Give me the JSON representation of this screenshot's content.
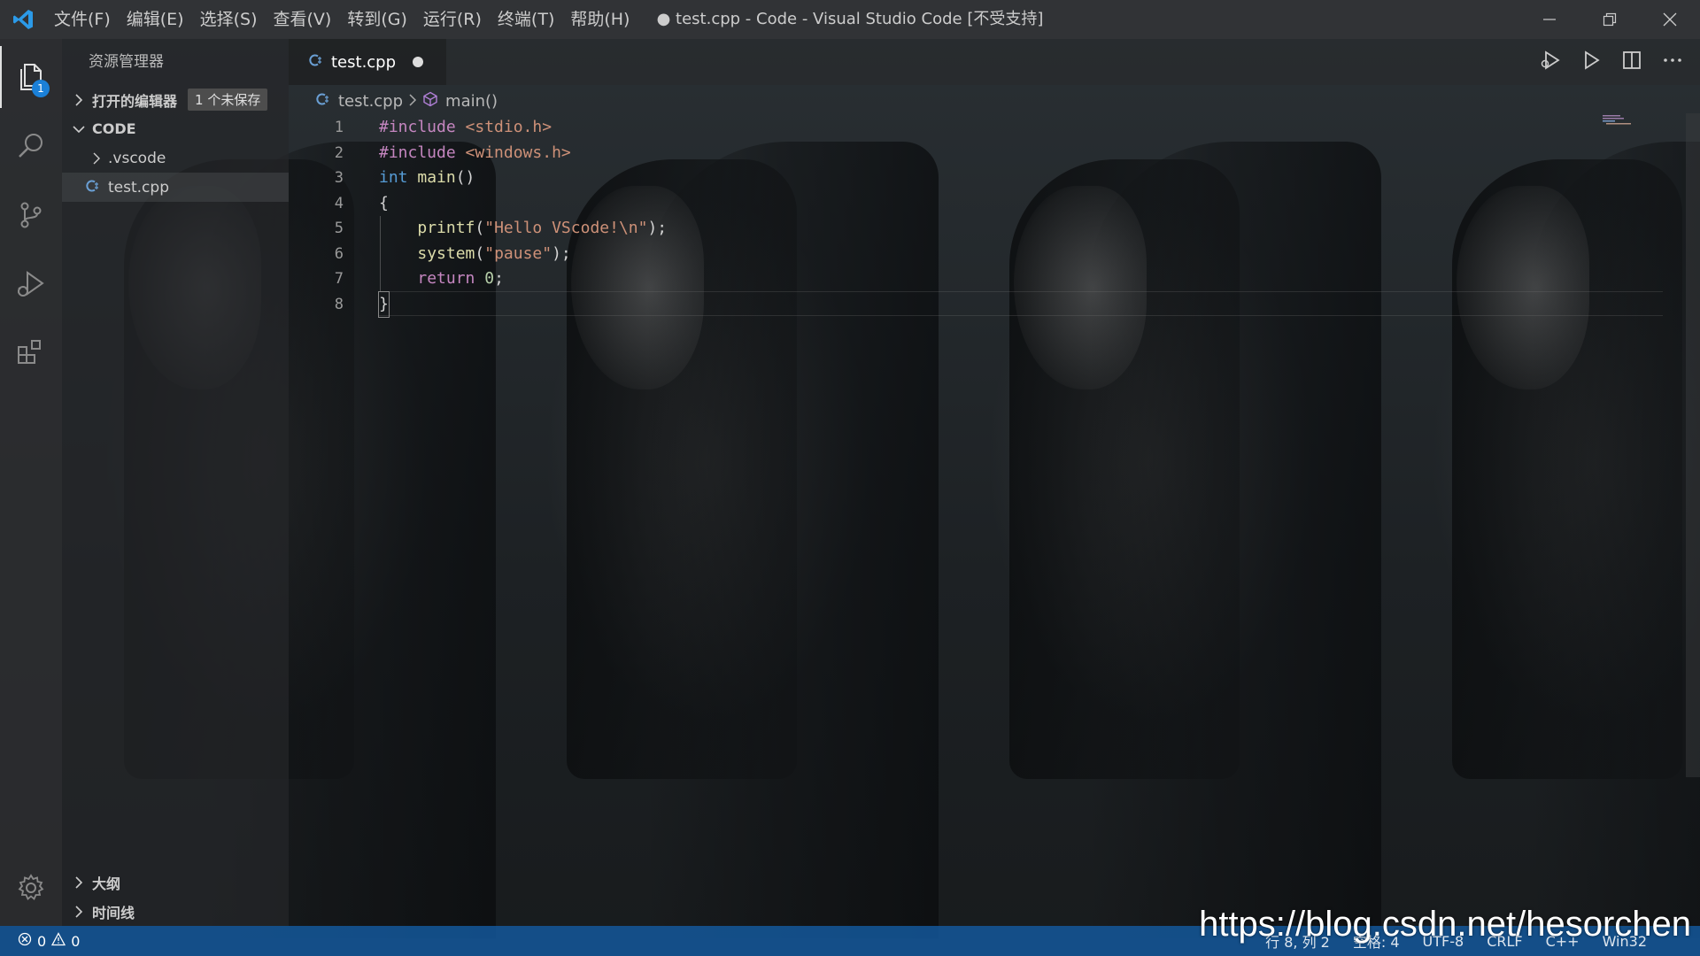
{
  "window": {
    "title": "● test.cpp - Code - Visual Studio Code [不受支持]"
  },
  "menu": {
    "items": [
      "文件(F)",
      "编辑(E)",
      "选择(S)",
      "查看(V)",
      "转到(G)",
      "运行(R)",
      "终端(T)",
      "帮助(H)"
    ]
  },
  "activity": {
    "explorer_badge": "1"
  },
  "sidebar": {
    "title": "资源管理器",
    "open_editors_label": "打开的编辑器",
    "open_editors_badge": "1 个未保存",
    "folder_label": "CODE",
    "items": [
      {
        "label": ".vscode"
      },
      {
        "label": "test.cpp"
      }
    ],
    "outline_label": "大纲",
    "timeline_label": "时间线"
  },
  "editor": {
    "tab_label": "test.cpp",
    "breadcrumb": {
      "file": "test.cpp",
      "symbol": "main()"
    },
    "line_numbers": [
      "1",
      "2",
      "3",
      "4",
      "5",
      "6",
      "7",
      "8"
    ],
    "code": {
      "l1_pre": "#include",
      "l1_inc": " <stdio.h>",
      "l2_pre": "#include",
      "l2_inc": " <windows.h>",
      "l3_type": "int",
      "l3_fn": "main",
      "l3_rest": "()",
      "l4": "{",
      "l5_fn": "printf",
      "l5_open": "(",
      "l5_str": "\"Hello VScode!\\n\"",
      "l5_close": ");",
      "l6_fn": "system",
      "l6_open": "(",
      "l6_str": "\"pause\"",
      "l6_close": ");",
      "l7_kw": "return",
      "l7_num": "0",
      "l7_end": ";",
      "l8": "}"
    }
  },
  "status": {
    "errors": "0",
    "warnings": "0",
    "right_items": [
      "行 8, 列 2",
      "空格: 4",
      "UTF-8",
      "CRLF",
      "C++",
      "Win32"
    ]
  },
  "watermark": "https://blog.csdn.net/hesorchen",
  "colors": {
    "accent": "#1b80d8",
    "statusbar": "#145aa0"
  },
  "icons": {
    "activity": [
      "files-icon",
      "search-icon",
      "source-control-icon",
      "run-debug-icon",
      "extensions-icon",
      "gear-icon"
    ],
    "editor_actions": [
      "run-debug-icon",
      "play-icon",
      "split-editor-icon",
      "more-icon"
    ]
  }
}
